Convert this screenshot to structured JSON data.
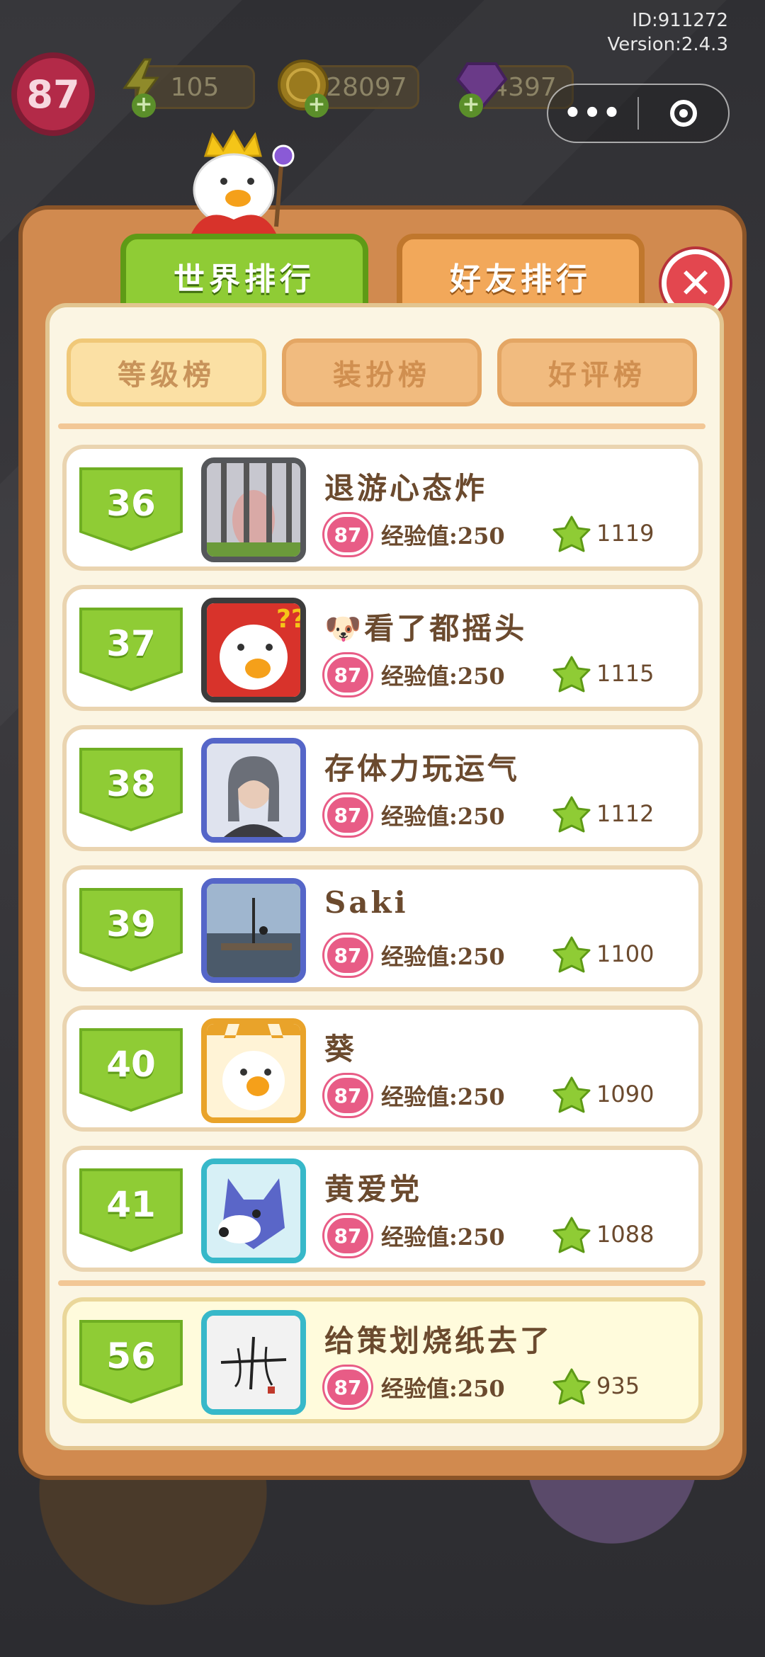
{
  "hud": {
    "id_label": "ID:911272",
    "version_label": "Version:2.4.3",
    "level": "87",
    "energy": "105",
    "coins": "228097",
    "gems": "4397"
  },
  "tabs": {
    "world": "世界排行",
    "friends": "好友排行"
  },
  "subtabs": [
    "等级榜",
    "装扮榜",
    "好评榜"
  ],
  "rows": [
    {
      "rank": "36",
      "name": "退游心态炸",
      "level": "87",
      "exp": "经验值:250",
      "score": "1119"
    },
    {
      "rank": "37",
      "name": "🐶看了都摇头",
      "level": "87",
      "exp": "经验值:250",
      "score": "1115"
    },
    {
      "rank": "38",
      "name": "存体力玩运气",
      "level": "87",
      "exp": "经验值:250",
      "score": "1112"
    },
    {
      "rank": "39",
      "name": "Saki",
      "level": "87",
      "exp": "经验值:250",
      "score": "1100"
    },
    {
      "rank": "40",
      "name": "葵",
      "level": "87",
      "exp": "经验值:250",
      "score": "1090"
    },
    {
      "rank": "41",
      "name": "黄爱党",
      "level": "87",
      "exp": "经验值:250",
      "score": "1088"
    }
  ],
  "me": {
    "rank": "56",
    "name": "给策划烧纸去了",
    "level": "87",
    "exp": "经验值:250",
    "score": "935"
  },
  "colors": {
    "green": "#8fcc35",
    "orange": "#f2a85a",
    "panel": "#d18a4f",
    "close_red": "#e3474f",
    "level_pink": "#e85c86"
  }
}
